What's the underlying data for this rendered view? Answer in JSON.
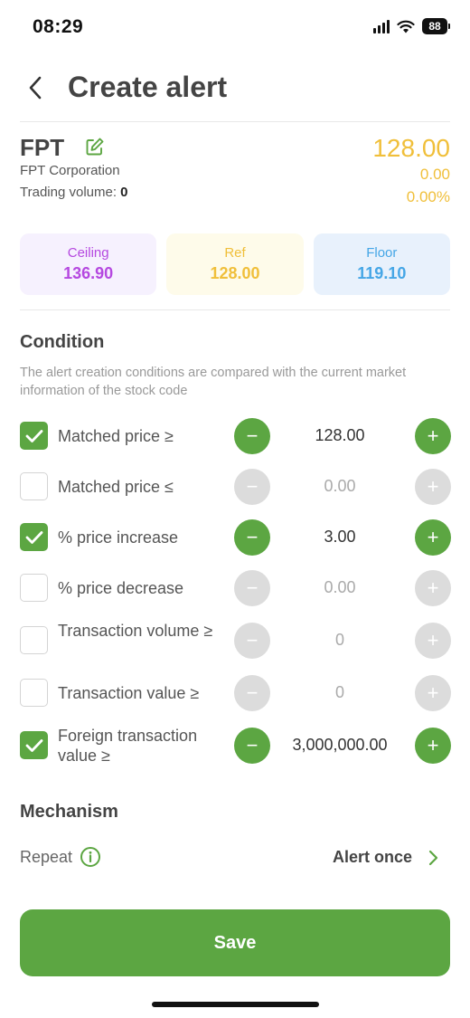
{
  "status_bar": {
    "time": "08:29",
    "battery": "88"
  },
  "header": {
    "title": "Create alert"
  },
  "stock": {
    "code": "FPT",
    "name": "FPT Corporation",
    "volume_label": "Trading volume: ",
    "volume_value": "0",
    "price": "128.00",
    "change": "0.00",
    "change_pct": "0.00%"
  },
  "limits": {
    "ceiling": {
      "label": "Ceiling",
      "value": "136.90"
    },
    "ref": {
      "label": "Ref",
      "value": "128.00"
    },
    "floor": {
      "label": "Floor",
      "value": "119.10"
    }
  },
  "condition": {
    "title": "Condition",
    "description": "The alert creation conditions are compared with the current market information of the stock code",
    "rows": [
      {
        "label": "Matched price ≥",
        "value": "128.00",
        "checked": true
      },
      {
        "label": "Matched price ≤",
        "value": "0.00",
        "checked": false
      },
      {
        "label": "% price increase",
        "value": "3.00",
        "checked": true
      },
      {
        "label": "% price decrease",
        "value": "0.00",
        "checked": false
      },
      {
        "label": "Transaction volume ≥",
        "value": "0",
        "checked": false
      },
      {
        "label": "Transaction value ≥",
        "value": "0",
        "checked": false
      },
      {
        "label": "Foreign transaction value ≥",
        "value": "3,000,000.00",
        "checked": true
      }
    ]
  },
  "mechanism": {
    "title": "Mechanism",
    "repeat_label": "Repeat",
    "repeat_value": "Alert once"
  },
  "save_label": "Save",
  "colors": {
    "accent_green": "#5ca642",
    "price_yellow": "#f0bf3a",
    "ceiling_purple": "#b548e0",
    "floor_blue": "#45a6e6"
  }
}
